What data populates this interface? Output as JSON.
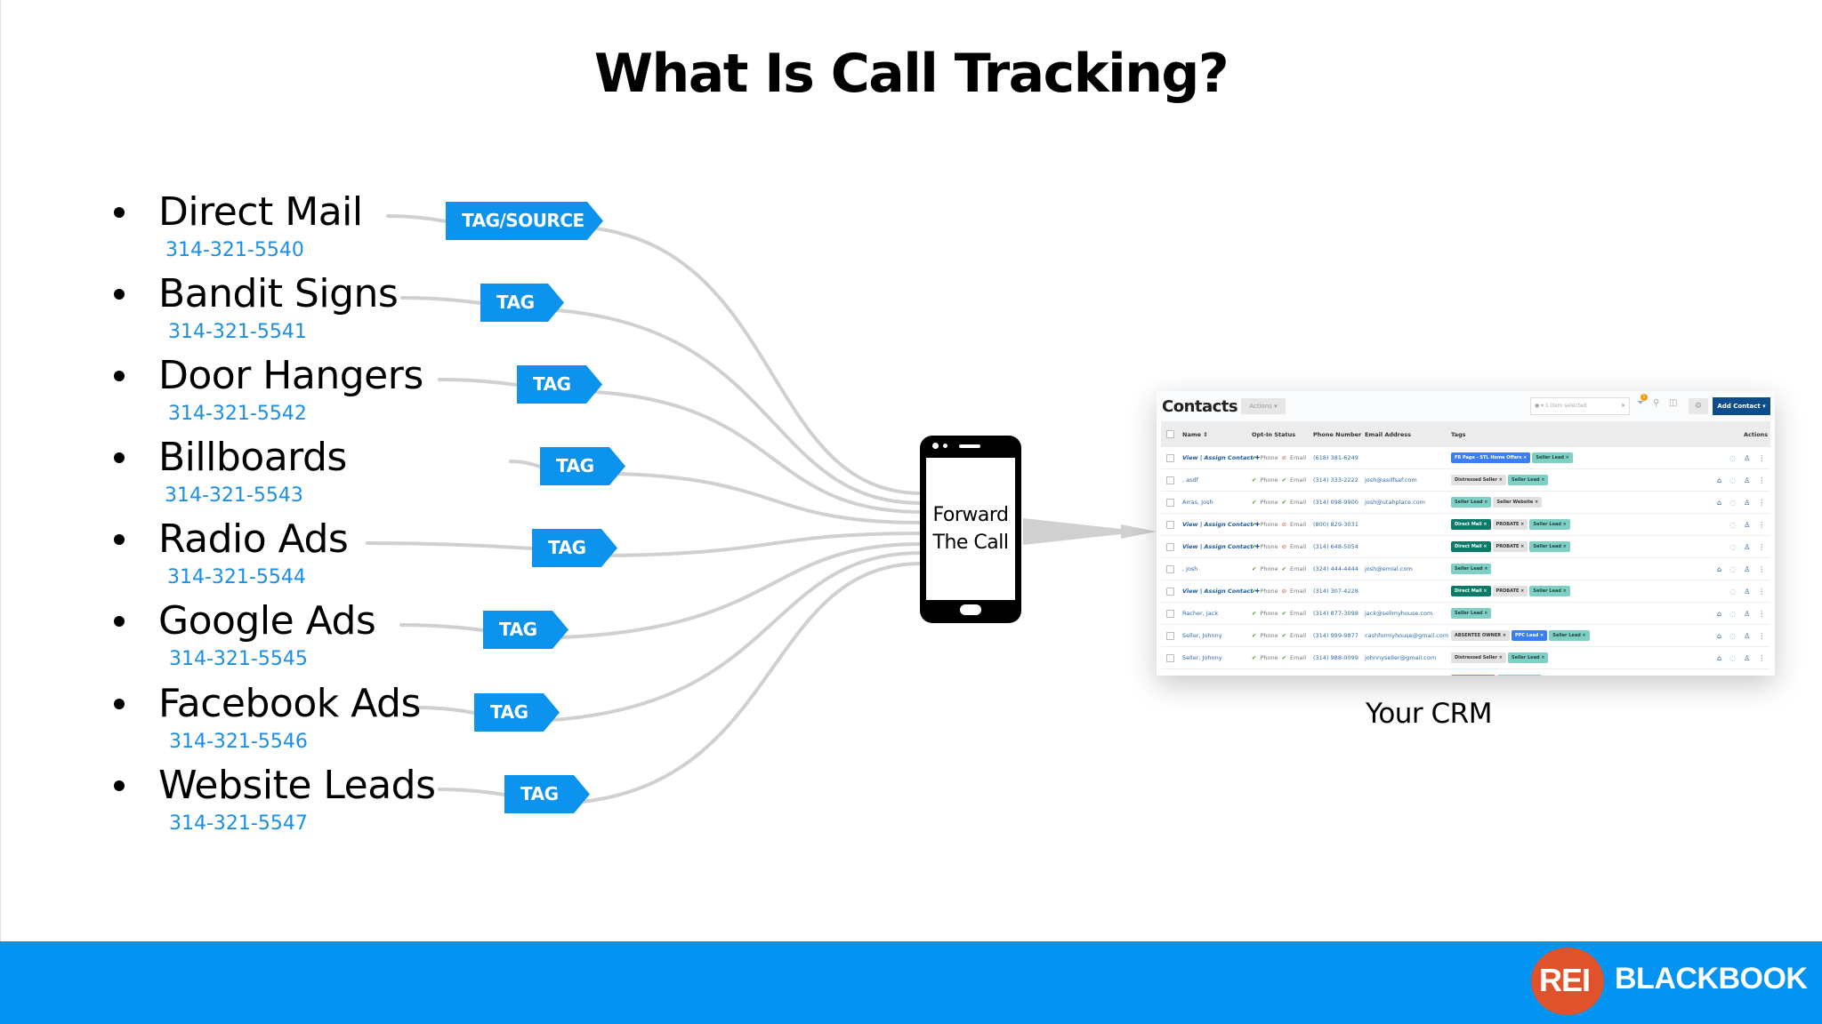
{
  "title": "What Is Call Tracking?",
  "sources": [
    {
      "name": "Direct Mail",
      "phone": "314-321-5540",
      "tag": "TAG/SOURCE"
    },
    {
      "name": "Bandit Signs",
      "phone": "314-321-5541",
      "tag": "TAG"
    },
    {
      "name": "Door Hangers",
      "phone": "314-321-5542",
      "tag": "TAG"
    },
    {
      "name": "Billboards",
      "phone": "314-321-5543",
      "tag": "TAG"
    },
    {
      "name": "Radio Ads",
      "phone": "314-321-5544",
      "tag": "TAG"
    },
    {
      "name": "Google Ads",
      "phone": "314-321-5545",
      "tag": "TAG"
    },
    {
      "name": "Facebook Ads",
      "phone": "314-321-5546",
      "tag": "TAG"
    },
    {
      "name": "Website Leads",
      "phone": "314-321-5547",
      "tag": "TAG"
    }
  ],
  "phone_device": {
    "line1": "Forward",
    "line2": "The Call"
  },
  "crm": {
    "label": "Your CRM",
    "title": "Contacts",
    "actions_button": "Actions ▾",
    "tag_filter": "● ▾  1 item selected",
    "tag_filter_clear": "×",
    "filter_badge": "1",
    "add_contact_button": "Add Contact ▾",
    "columns": [
      "Name ⇕",
      "Opt-In Status",
      "Phone Number",
      "Email Address",
      "Tags",
      "Actions"
    ],
    "rows": [
      {
        "name": "View | Assign Contact ✚",
        "assign": true,
        "phone_opt": "Phone",
        "email_opt": "Email",
        "email_ok": false,
        "phone": "(618) 381-6249",
        "email": "",
        "tags": [
          {
            "label": "FB Page - STL Home Offers ×",
            "color": "blue"
          },
          {
            "label": "Seller Lead ×",
            "color": "teal"
          }
        ],
        "home": false
      },
      {
        "name": ", asdf",
        "assign": false,
        "phone_opt": "Phone",
        "email_opt": "Email",
        "email_ok": true,
        "phone": "(314) 333-2222",
        "email": "josh@asdfsaf.com",
        "tags": [
          {
            "label": "Distressed Seller ×",
            "color": "gray"
          },
          {
            "label": "Seller Lead ×",
            "color": "teal"
          }
        ],
        "home": true
      },
      {
        "name": "Arras, Josh",
        "assign": false,
        "phone_opt": "Phone",
        "email_opt": "Email",
        "email_ok": true,
        "phone": "(314) 098-9900",
        "email": "josh@utahplace.com",
        "tags": [
          {
            "label": "Seller Lead ×",
            "color": "teal"
          },
          {
            "label": "Seller Website ×",
            "color": "gray"
          }
        ],
        "home": true
      },
      {
        "name": "View | Assign Contact ✚",
        "assign": true,
        "phone_opt": "Phone",
        "email_opt": "Email",
        "email_ok": false,
        "phone": "(800) 829-3031",
        "email": "",
        "tags": [
          {
            "label": "Direct Mail ×",
            "color": "dark"
          },
          {
            "label": "PROBATE ×",
            "color": "gray"
          },
          {
            "label": "Seller Lead ×",
            "color": "teal"
          }
        ],
        "home": false
      },
      {
        "name": "View | Assign Contact ✚",
        "assign": true,
        "phone_opt": "Phone",
        "email_opt": "Email",
        "email_ok": false,
        "phone": "(314) 648-5054",
        "email": "",
        "tags": [
          {
            "label": "Direct Mail ×",
            "color": "dark"
          },
          {
            "label": "PROBATE ×",
            "color": "gray"
          },
          {
            "label": "Seller Lead ×",
            "color": "teal"
          }
        ],
        "home": false
      },
      {
        "name": ", josh",
        "assign": false,
        "phone_opt": "Phone",
        "email_opt": "Email",
        "email_ok": true,
        "phone": "(324) 444-4444",
        "email": "josh@emial.com",
        "tags": [
          {
            "label": "Seller Lead ×",
            "color": "teal"
          }
        ],
        "home": true
      },
      {
        "name": "View | Assign Contact ✚",
        "assign": true,
        "phone_opt": "Phone",
        "email_opt": "Email",
        "email_ok": false,
        "phone": "(314) 307-4228",
        "email": "",
        "tags": [
          {
            "label": "Direct Mail ×",
            "color": "dark"
          },
          {
            "label": "PROBATE ×",
            "color": "gray"
          },
          {
            "label": "Seller Lead ×",
            "color": "teal"
          }
        ],
        "home": false
      },
      {
        "name": "Racher, Jack",
        "assign": false,
        "phone_opt": "Phone",
        "email_opt": "Email",
        "email_ok": true,
        "phone": "(314) 877-3098",
        "email": "jack@sellmyhouse.com",
        "tags": [
          {
            "label": "Seller Lead ×",
            "color": "teal"
          }
        ],
        "home": true
      },
      {
        "name": "Seller, Johnny",
        "assign": false,
        "phone_opt": "Phone",
        "email_opt": "Email",
        "email_ok": true,
        "phone": "(314) 999-9877",
        "email": "cashformyhouse@gmail.com",
        "tags": [
          {
            "label": "ABSENTEE OWNER ×",
            "color": "gray"
          },
          {
            "label": "PPC Lead ×",
            "color": "blue"
          },
          {
            "label": "Seller Lead ×",
            "color": "teal"
          }
        ],
        "home": true
      },
      {
        "name": "Seller, Johnny",
        "assign": false,
        "phone_opt": "Phone",
        "email_opt": "Email",
        "email_ok": true,
        "phone": "(314) 988-0099",
        "email": "johnnyseller@gmail.com",
        "tags": [
          {
            "label": "Distressed Seller ×",
            "color": "gray"
          },
          {
            "label": "Seller Lead ×",
            "color": "teal"
          }
        ],
        "home": true
      },
      {
        "name": "",
        "assign": false,
        "phone_opt": "",
        "email_opt": "",
        "email_ok": true,
        "phone": "",
        "email": "",
        "tags": [
          {
            "label": "",
            "color": "orange"
          },
          {
            "label": "",
            "color": "teal"
          }
        ],
        "home": false
      }
    ]
  },
  "footer": {
    "logo_mark": "REI",
    "logo_text": "BLACKBOOK"
  },
  "colors": {
    "accent_blue": "#0294f0",
    "tag_blue": "#0b93ee",
    "phone_text": "#1a8fe3",
    "logo_red": "#e0522b"
  }
}
